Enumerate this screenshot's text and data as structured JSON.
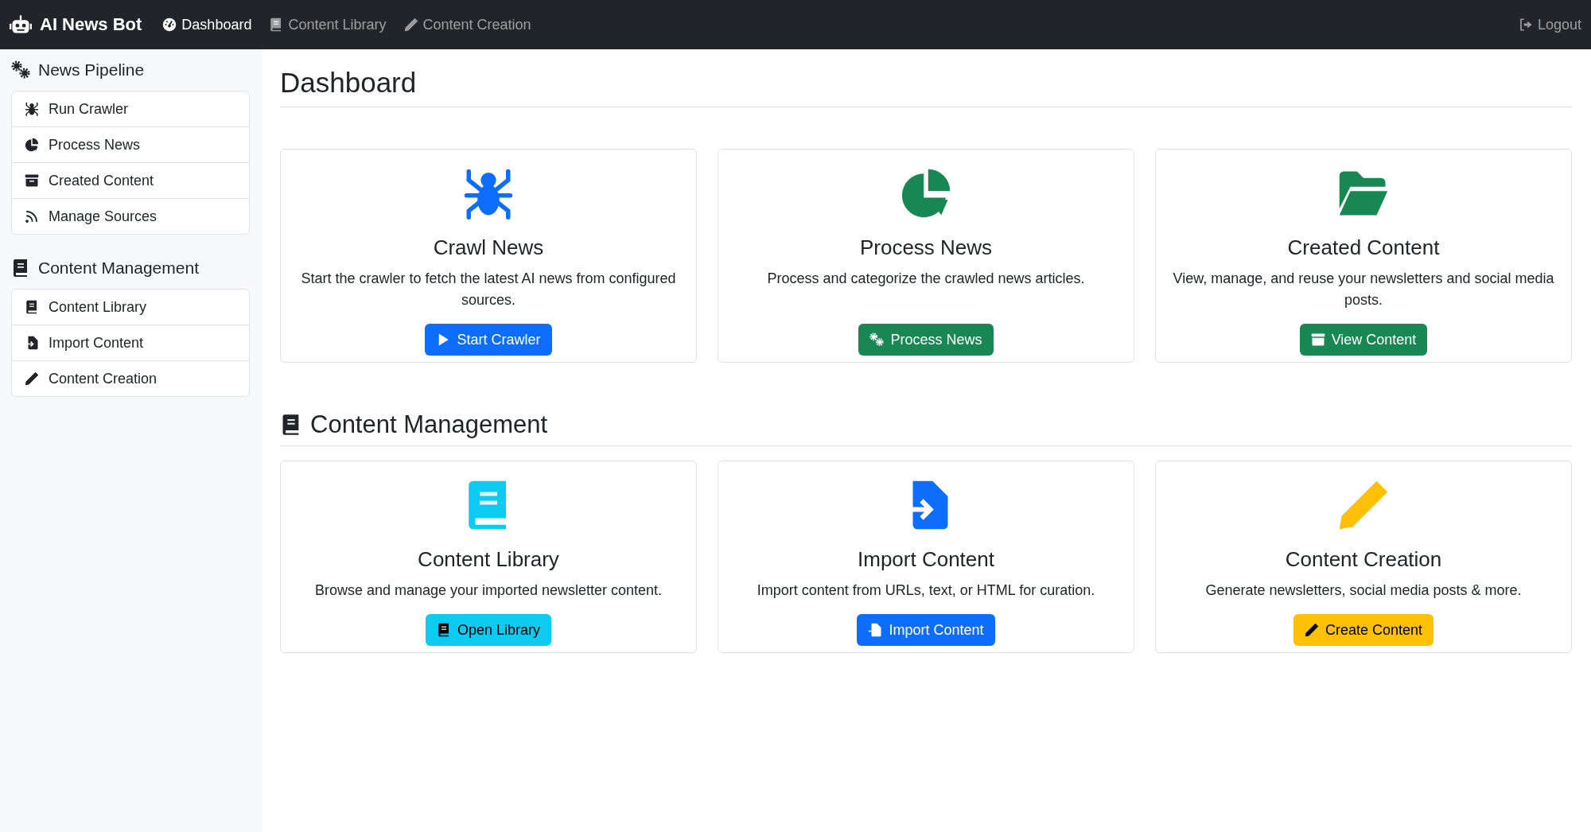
{
  "navbar": {
    "brand": "AI News Bot",
    "links": [
      {
        "label": "Dashboard",
        "selected": true
      },
      {
        "label": "Content Library",
        "selected": false
      },
      {
        "label": "Content Creation",
        "selected": false
      }
    ],
    "logout": "Logout"
  },
  "sidebar": {
    "sections": [
      {
        "title": "News Pipeline",
        "items": [
          "Run Crawler",
          "Process News",
          "Created Content",
          "Manage Sources"
        ]
      },
      {
        "title": "Content Management",
        "items": [
          "Content Library",
          "Import Content",
          "Content Creation"
        ]
      }
    ]
  },
  "main": {
    "title": "Dashboard",
    "sections": [
      {
        "cards": [
          {
            "title": "Crawl News",
            "description": "Start the crawler to fetch the latest AI news from configured sources.",
            "button": "Start Crawler"
          },
          {
            "title": "Process News",
            "description": "Process and categorize the crawled news articles.",
            "button": "Process News"
          },
          {
            "title": "Created Content",
            "description": "View, manage, and reuse your newsletters and social media posts.",
            "button": "View Content"
          }
        ]
      },
      {
        "title": "Content Management",
        "cards": [
          {
            "title": "Content Library",
            "description": "Browse and manage your imported newsletter content.",
            "button": "Open Library"
          },
          {
            "title": "Import Content",
            "description": "Import content from URLs, text, or HTML for curation.",
            "button": "Import Content"
          },
          {
            "title": "Content Creation",
            "description": "Generate newsletters, social media posts & more.",
            "button": "Create Content"
          }
        ]
      }
    ]
  }
}
